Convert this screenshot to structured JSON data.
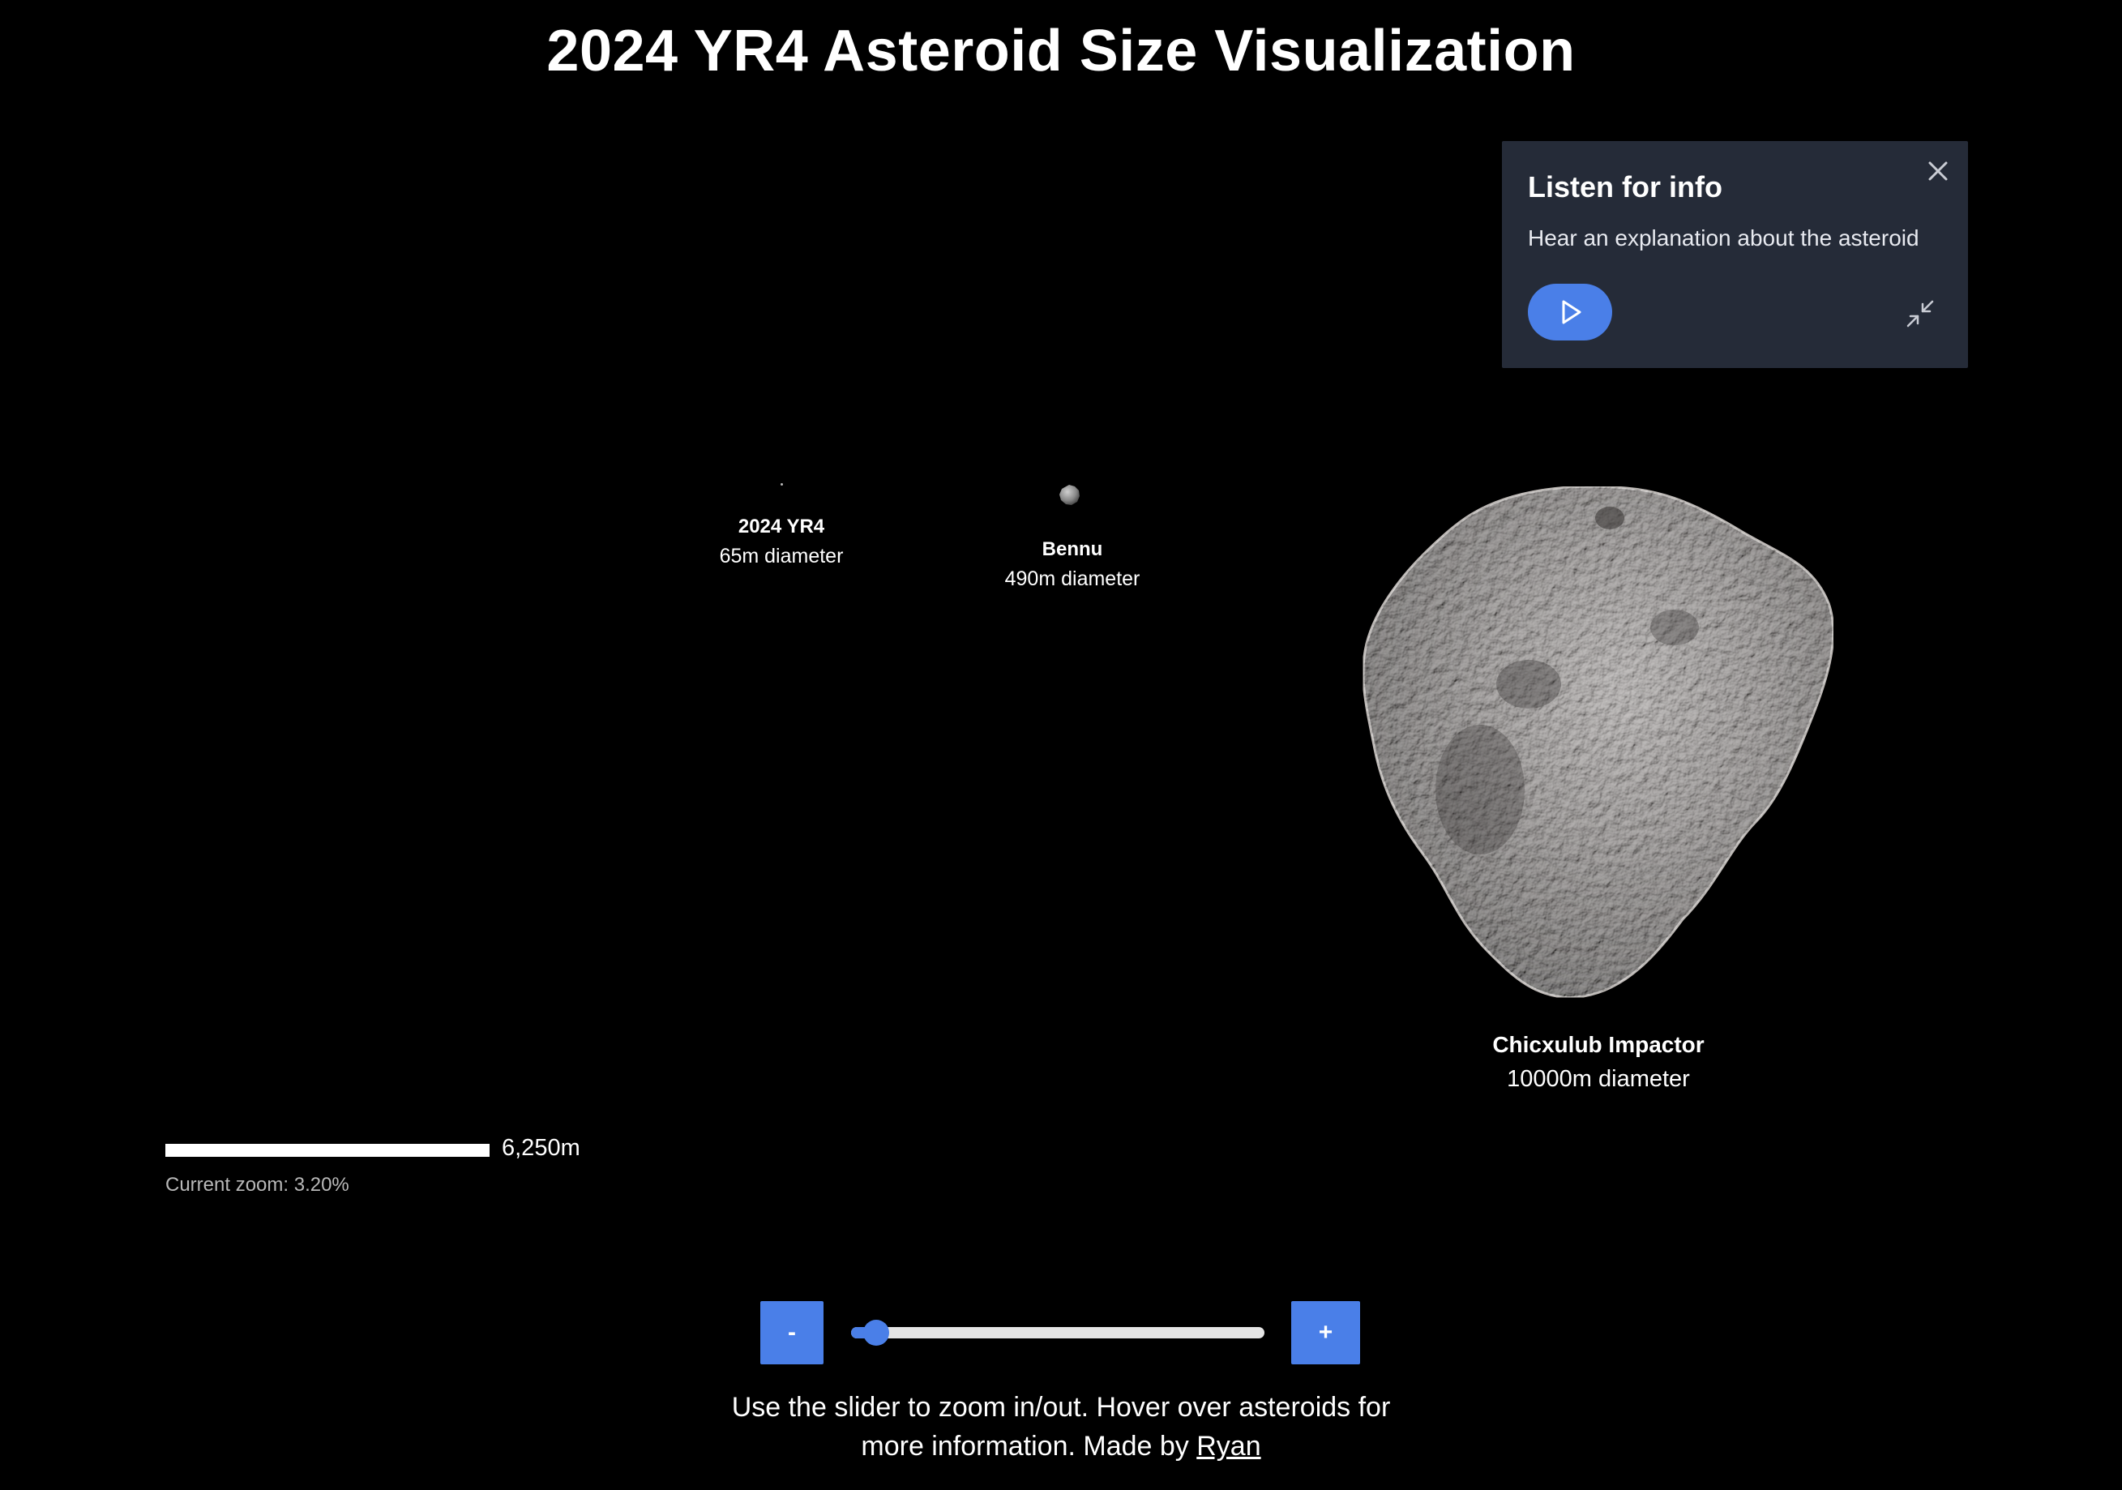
{
  "page": {
    "title": "2024 YR4 Asteroid Size Visualization"
  },
  "info_card": {
    "title": "Listen for info",
    "text": "Hear an explanation about the asteroid",
    "close_icon": "close-icon",
    "play_icon": "play-icon",
    "minimize_icon": "minimize-icon"
  },
  "asteroids": [
    {
      "name": "2024 YR4",
      "diameter": "65m diameter"
    },
    {
      "name": "Bennu",
      "diameter": "490m diameter"
    },
    {
      "name": "Chicxulub Impactor",
      "diameter": "10000m diameter"
    }
  ],
  "scale": {
    "label": "6,250m",
    "zoom_text": "Current zoom: 3.20%"
  },
  "controls": {
    "zoom_out_label": "-",
    "zoom_in_label": "+",
    "slider_value_fraction": 0.032
  },
  "footer": {
    "line1": "Use the slider to zoom in/out. Hover over asteroids for",
    "line2_prefix": "more information. Made by ",
    "link_text": "Ryan"
  },
  "colors": {
    "background": "#000000",
    "accent": "#4a7fe8",
    "card_bg": "#252b38"
  }
}
